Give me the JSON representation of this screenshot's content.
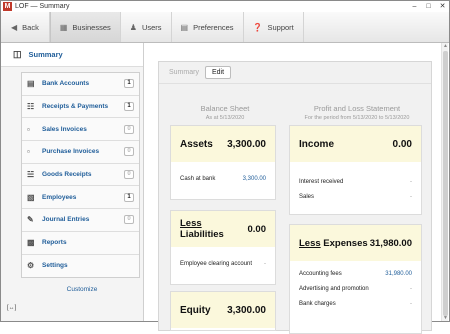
{
  "window": {
    "title": "LOF — Summary",
    "logo_letter": "M"
  },
  "toolbar": {
    "back": "Back",
    "businesses": "Businesses",
    "users": "Users",
    "preferences": "Preferences",
    "support": "Support"
  },
  "sidebar": {
    "summary": "Summary",
    "items": [
      {
        "label": "Bank Accounts",
        "count": "1"
      },
      {
        "label": "Receipts & Payments",
        "count": "1"
      },
      {
        "label": "Sales Invoices",
        "count": "0"
      },
      {
        "label": "Purchase Invoices",
        "count": "0"
      },
      {
        "label": "Goods Receipts",
        "count": "0"
      },
      {
        "label": "Employees",
        "count": "1"
      },
      {
        "label": "Journal Entries",
        "count": "0"
      },
      {
        "label": "Reports"
      },
      {
        "label": "Settings"
      }
    ],
    "customize": "Customize",
    "footer": "[↔]"
  },
  "main": {
    "tab_summary": "Summary",
    "edit_label": "Edit",
    "balance_sheet": {
      "title": "Balance Sheet",
      "subtitle": "As at 5/13/2020",
      "assets": {
        "label": "Assets",
        "total": "3,300.00",
        "rows": [
          {
            "name": "Cash at bank",
            "value": "3,300.00"
          }
        ]
      },
      "liabilities": {
        "prefix": "Less",
        "label": "Liabilities",
        "total": "0.00",
        "rows": [
          {
            "name": "Employee clearing account",
            "value": "-"
          }
        ]
      },
      "equity": {
        "label": "Equity",
        "total": "3,300.00"
      }
    },
    "pl_statement": {
      "title": "Profit and Loss Statement",
      "subtitle": "For the period from 5/13/2020 to 5/13/2020",
      "income": {
        "label": "Income",
        "total": "0.00",
        "rows": [
          {
            "name": "Interest received",
            "value": "-"
          },
          {
            "name": "Sales",
            "value": "-"
          }
        ]
      },
      "expenses": {
        "prefix": "Less",
        "label": "Expenses",
        "total": "31,980.00",
        "rows": [
          {
            "name": "Accounting fees",
            "value": "31,980.00"
          },
          {
            "name": "Advertising and promotion",
            "value": "-"
          },
          {
            "name": "Bank charges",
            "value": "-"
          }
        ]
      }
    }
  },
  "colors": {
    "accent": "#1f5d99",
    "card_header": "#fbf8dc",
    "logo": "#c0392b"
  }
}
